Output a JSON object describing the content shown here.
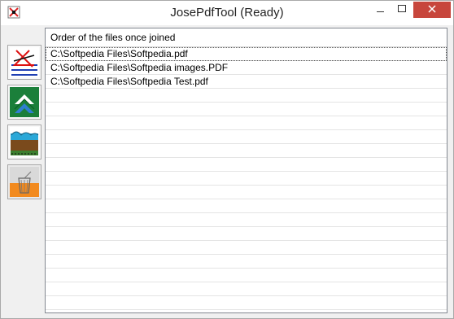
{
  "window": {
    "title": "JosePdfTool (Ready)"
  },
  "list": {
    "header": "Order of the files once joined",
    "files": [
      "C:\\Softpedia Files\\Softpedia.pdf",
      "C:\\Softpedia Files\\Softpedia images.PDF",
      "C:\\Softpedia Files\\Softpedia Test.pdf"
    ],
    "empty_rows": 17
  },
  "toolbar": {
    "buttons": [
      {
        "icon": "add-files-icon"
      },
      {
        "icon": "move-up-icon"
      },
      {
        "icon": "join-pdf-icon"
      },
      {
        "icon": "delete-trash-icon"
      }
    ]
  },
  "colors": {
    "close_button": "#c7463c",
    "trash_fill": "#f28a1e",
    "arrow_green": "#1b7f3a",
    "arrow_blue": "#2f7fd1"
  }
}
